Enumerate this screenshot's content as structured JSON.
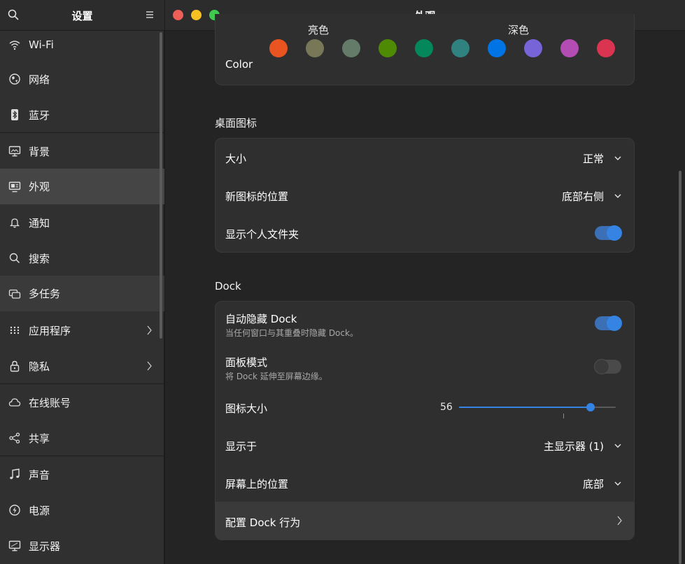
{
  "sidebar": {
    "title": "设置",
    "items": [
      {
        "label": "Wi-Fi",
        "icon": "wifi-icon"
      },
      {
        "label": "网络",
        "icon": "network-icon"
      },
      {
        "label": "蓝牙",
        "icon": "bluetooth-icon"
      },
      {
        "label": "背景",
        "icon": "background-icon"
      },
      {
        "label": "外观",
        "icon": "appearance-icon"
      },
      {
        "label": "通知",
        "icon": "bell-icon"
      },
      {
        "label": "搜索",
        "icon": "search-icon"
      },
      {
        "label": "多任务",
        "icon": "multitasking-icon"
      },
      {
        "label": "应用程序",
        "icon": "apps-grid-icon"
      },
      {
        "label": "隐私",
        "icon": "lock-icon"
      },
      {
        "label": "在线账号",
        "icon": "cloud-icon"
      },
      {
        "label": "共享",
        "icon": "share-icon"
      },
      {
        "label": "声音",
        "icon": "music-note-icon"
      },
      {
        "label": "电源",
        "icon": "power-icon"
      },
      {
        "label": "显示器",
        "icon": "display-icon"
      }
    ],
    "active": "外观"
  },
  "window": {
    "title": "外观",
    "buttons": {
      "close_color": "#ed5f57",
      "minimize_color": "#f7c023",
      "maximize_color": "#3fc950"
    }
  },
  "style_card": {
    "light_label": "亮色",
    "dark_label": "深色",
    "color_label": "Color",
    "colors": [
      "#e95420",
      "#787859",
      "#657b69",
      "#4e8a04",
      "#03875b",
      "#308280",
      "#0073e5",
      "#7764d8",
      "#b34cb3",
      "#da3450"
    ]
  },
  "desktop_icons": {
    "section_title": "桌面图标",
    "size_label": "大小",
    "size_value": "正常",
    "new_icon_pos_label": "新图标的位置",
    "new_icon_pos_value": "底部右侧",
    "show_home_label": "显示个人文件夹",
    "show_home_on": true
  },
  "dock": {
    "section_title": "Dock",
    "autohide_label": "自动隐藏 Dock",
    "autohide_sub": "当任何窗口与其重叠时隐藏 Dock。",
    "autohide_on": true,
    "panel_label": "面板模式",
    "panel_sub": "将 Dock 延伸至屏幕边缘。",
    "panel_on": false,
    "icon_size_label": "图标大小",
    "icon_size_value": "56",
    "icon_size_fraction": 0.84,
    "show_on_label": "显示于",
    "show_on_value": "主显示器 (1)",
    "position_label": "屏幕上的位置",
    "position_value": "底部",
    "configure_label": "配置 Dock 行为"
  },
  "accent_color": "#3584e4"
}
